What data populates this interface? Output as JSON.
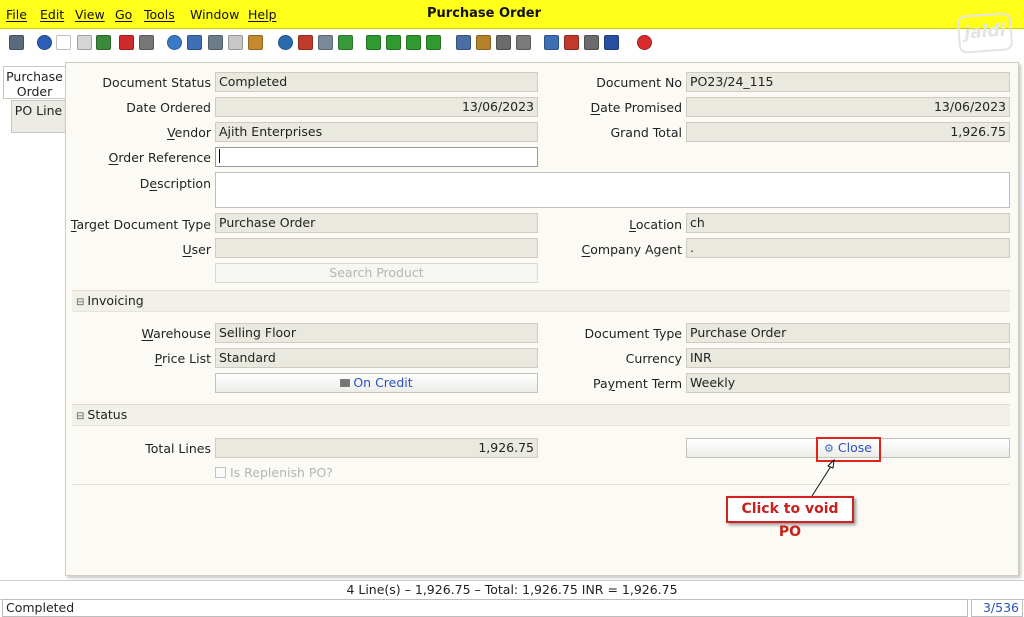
{
  "window": {
    "title": "Purchase Order",
    "logo_text": "jaldi"
  },
  "menu": [
    "File",
    "Edit",
    "View",
    "Go",
    "Tools",
    "Window",
    "Help"
  ],
  "toolbar_icons": [
    {
      "name": "undo-icon",
      "color": "#5a6b7d"
    },
    {
      "name": "help-icon",
      "color": "#2d5fb8"
    },
    {
      "name": "new-record-icon",
      "color": "#ffffff"
    },
    {
      "name": "copy-record-icon",
      "color": "#d5d5d5"
    },
    {
      "name": "save-icon",
      "color": "#3a8a3a"
    },
    {
      "name": "delete-icon",
      "color": "#d02b2b"
    },
    {
      "name": "delete-selection-icon",
      "color": "#777777"
    },
    {
      "name": "refresh-icon",
      "color": "#3a7bc8"
    },
    {
      "name": "find-icon",
      "color": "#3d6fb4"
    },
    {
      "name": "attachment-icon",
      "color": "#6d7c8c"
    },
    {
      "name": "chat-icon",
      "color": "#c8c8c8"
    },
    {
      "name": "grid-toggle-icon",
      "color": "#c58a2e"
    },
    {
      "name": "history-icon",
      "color": "#2a6bb0"
    },
    {
      "name": "home-icon",
      "color": "#c03b2b"
    },
    {
      "name": "back-icon",
      "color": "#7a8a9a"
    },
    {
      "name": "forward-icon",
      "color": "#3a9a3a"
    },
    {
      "name": "first-record-icon",
      "color": "#2f9a2f"
    },
    {
      "name": "previous-record-icon",
      "color": "#2f9a2f"
    },
    {
      "name": "next-record-icon",
      "color": "#2f9a2f"
    },
    {
      "name": "last-record-icon",
      "color": "#2f9a2f"
    },
    {
      "name": "report-icon",
      "color": "#4a6fa5"
    },
    {
      "name": "archive-icon",
      "color": "#b5822a"
    },
    {
      "name": "print-preview-icon",
      "color": "#6b6b6b"
    },
    {
      "name": "print-icon",
      "color": "#7a7a7a"
    },
    {
      "name": "zoom-across-icon",
      "color": "#3d6fb4"
    },
    {
      "name": "workflow-icon",
      "color": "#c0392b"
    },
    {
      "name": "product-info-icon",
      "color": "#6b6b6b"
    },
    {
      "name": "request-icon",
      "color": "#2a4fa0"
    },
    {
      "name": "exit-icon",
      "color": "#d92b2b"
    }
  ],
  "tabs": [
    {
      "label": "Purchase Order",
      "active": true
    },
    {
      "label": "PO Line",
      "active": false
    }
  ],
  "form": {
    "document_status": {
      "label": "Document Status",
      "value": "Completed"
    },
    "document_no": {
      "label": "Document No",
      "value": "PO23/24_115"
    },
    "date_ordered": {
      "label": "Date Ordered",
      "value": "13/06/2023"
    },
    "date_promised": {
      "label": "Date Promised",
      "value": "13/06/2023"
    },
    "vendor": {
      "label": "Vendor",
      "value": "Ajith Enterprises"
    },
    "grand_total": {
      "label": "Grand Total",
      "value": "1,926.75"
    },
    "order_reference": {
      "label": "Order Reference",
      "value": ""
    },
    "description": {
      "label": "Description",
      "value": ""
    },
    "target_document_type": {
      "label": "Target Document Type",
      "value": "Purchase Order"
    },
    "location": {
      "label": "Location",
      "value": "ch"
    },
    "user": {
      "label": "User",
      "value": ""
    },
    "company_agent": {
      "label": "Company Agent",
      "value": "."
    },
    "search_product": "Search Product"
  },
  "invoicing": {
    "title": "Invoicing",
    "warehouse": {
      "label": "Warehouse",
      "value": "Selling Floor"
    },
    "document_type": {
      "label": "Document Type",
      "value": "Purchase Order"
    },
    "price_list": {
      "label": "Price List",
      "value": "Standard"
    },
    "currency": {
      "label": "Currency",
      "value": "INR"
    },
    "payment_rule": "On Credit",
    "payment_term": {
      "label": "Payment Term",
      "value": "Weekly"
    }
  },
  "status_section": {
    "title": "Status",
    "total_lines": {
      "label": "Total Lines",
      "value": "1,926.75"
    },
    "replenish_label": "Is Replenish PO?",
    "close_button": "Close"
  },
  "annotation": {
    "callout": "Click to void PO",
    "color": "#d32020"
  },
  "footer": {
    "summary": "4 Line(s) – 1,926.75 –  Total: 1,926.75  INR  =  1,926.75",
    "status": "Completed",
    "record": "3/536"
  }
}
